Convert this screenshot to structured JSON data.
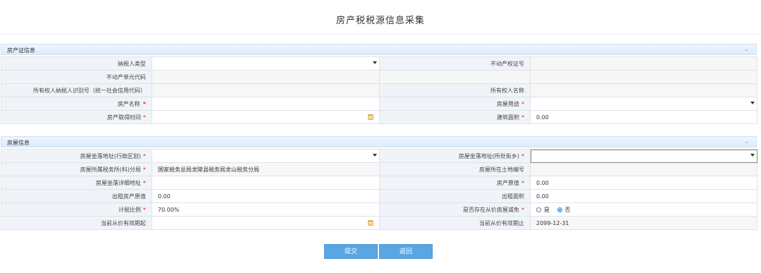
{
  "page": {
    "title": "房产税税源信息采集"
  },
  "section1": {
    "title": "房产证信息",
    "rows": [
      {
        "l1": "纳税人类型",
        "v1": "",
        "l2": "不动产权证号",
        "v2": ""
      },
      {
        "l1": "不动产单元代码",
        "v1": "",
        "l2": "",
        "v2": ""
      },
      {
        "l1": "所有权人纳税人识别号（统一社会信用代码）",
        "v1": "",
        "l2": "所有权人名称",
        "v2": ""
      },
      {
        "l1": "房产名称",
        "v1": "",
        "l2": "房屋用途",
        "v2": ""
      },
      {
        "l1": "房产取得时间",
        "v1": "",
        "l2": "建筑面积",
        "v2": "0.00"
      }
    ]
  },
  "section2": {
    "title": "房屋信息",
    "rows": [
      {
        "l1": "房屋坐落地址(行政区划)",
        "v1": "",
        "l2": "房屋坐落地址(所处街乡)",
        "v2": ""
      },
      {
        "l1": "房屋所属税务所(科)分局",
        "v1": "国家税务总局龙陵县税务局龙山税务分局",
        "l2": "房屋所在土地编号",
        "v2": ""
      },
      {
        "l1": "房屋坐落详细地址",
        "v1": "",
        "l2": "房产原值",
        "v2": "0.00"
      },
      {
        "l1": "出租房产原值",
        "v1": "0.00",
        "l2": "出租面积",
        "v2": "0.00"
      },
      {
        "l1": "计税比例",
        "v1": "70.00%",
        "l2": "是否存在从价房屋减免",
        "v2": ""
      },
      {
        "l1": "当前从价有效期起",
        "v1": "",
        "l2": "当前从价有效期止",
        "v2": "2099-12-31"
      }
    ],
    "radio_yes": "是",
    "radio_no": "否",
    "radio_selected": "否"
  },
  "buttons": {
    "submit": "提交",
    "back": "返回"
  },
  "icons": {
    "dropdown": "caret-down-icon",
    "calendar": "calendar-icon",
    "collapse": "chevron-down-icon"
  },
  "colors": {
    "accent": "#5aa6e2",
    "required": "#e02020",
    "section_header": "#dcebfa"
  }
}
